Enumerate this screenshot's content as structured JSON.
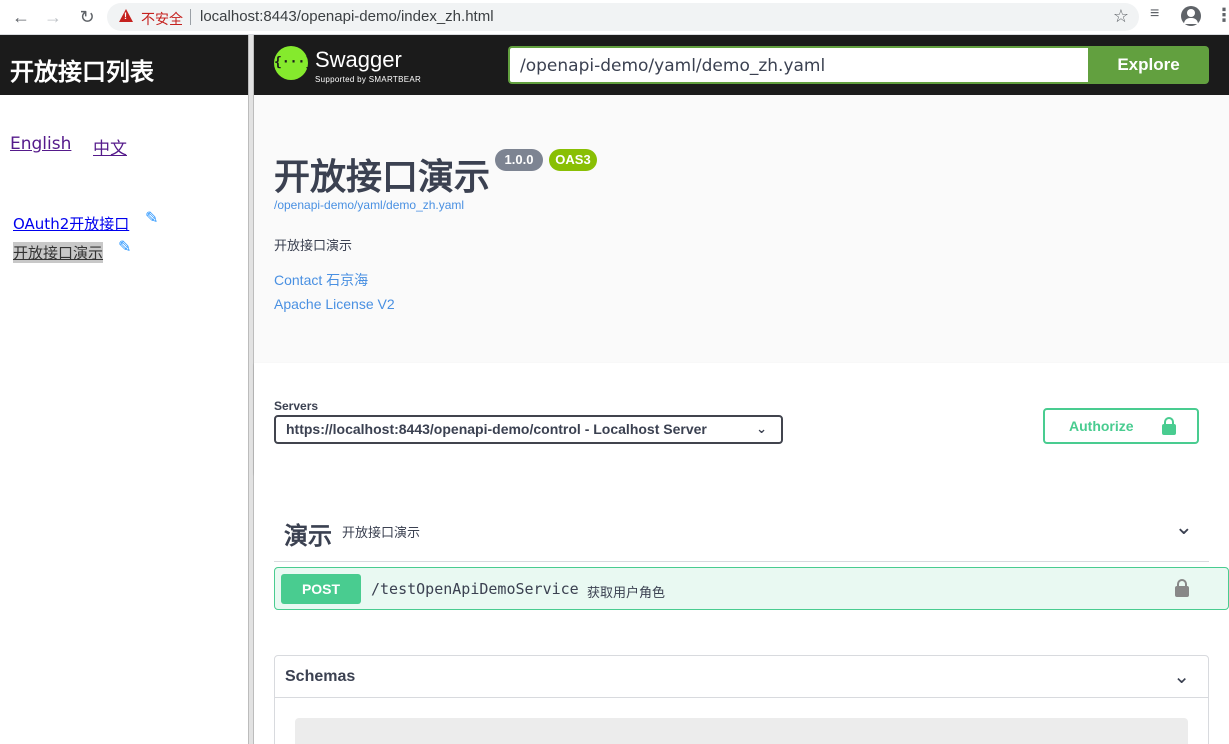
{
  "browser": {
    "security_label": "不安全",
    "url": "localhost:8443/openapi-demo/index_zh.html"
  },
  "sidebar": {
    "title": "开放接口列表",
    "languages": [
      "English",
      "中文"
    ],
    "apis": [
      "OAuth2开放接口",
      "开放接口演示"
    ]
  },
  "topbar": {
    "logo_name": "Swagger",
    "logo_sub": "Supported by SMARTBEAR",
    "spec_url": "/openapi-demo/yaml/demo_zh.yaml",
    "explore_label": "Explore"
  },
  "info": {
    "title": "开放接口演示",
    "version": "1.0.0",
    "oas": "OAS3",
    "url": "/openapi-demo/yaml/demo_zh.yaml",
    "description": "开放接口演示",
    "contact": "Contact 石京海",
    "license": "Apache License V2"
  },
  "servers": {
    "label": "Servers",
    "selected": "https://localhost:8443/openapi-demo/control - Localhost Server"
  },
  "authorize": {
    "label": "Authorize"
  },
  "tag": {
    "name": "演示",
    "description": "开放接口演示",
    "operations": [
      {
        "method": "POST",
        "path": "/testOpenApiDemoService",
        "summary": "获取用户角色"
      }
    ]
  },
  "models": {
    "title": "Schemas"
  },
  "colors": {
    "post_green": "#49cc90",
    "swagger_green": "#62a03f",
    "link_blue": "#4990e2",
    "version_badge": "#7d8492",
    "oas_badge": "#89bf04"
  }
}
